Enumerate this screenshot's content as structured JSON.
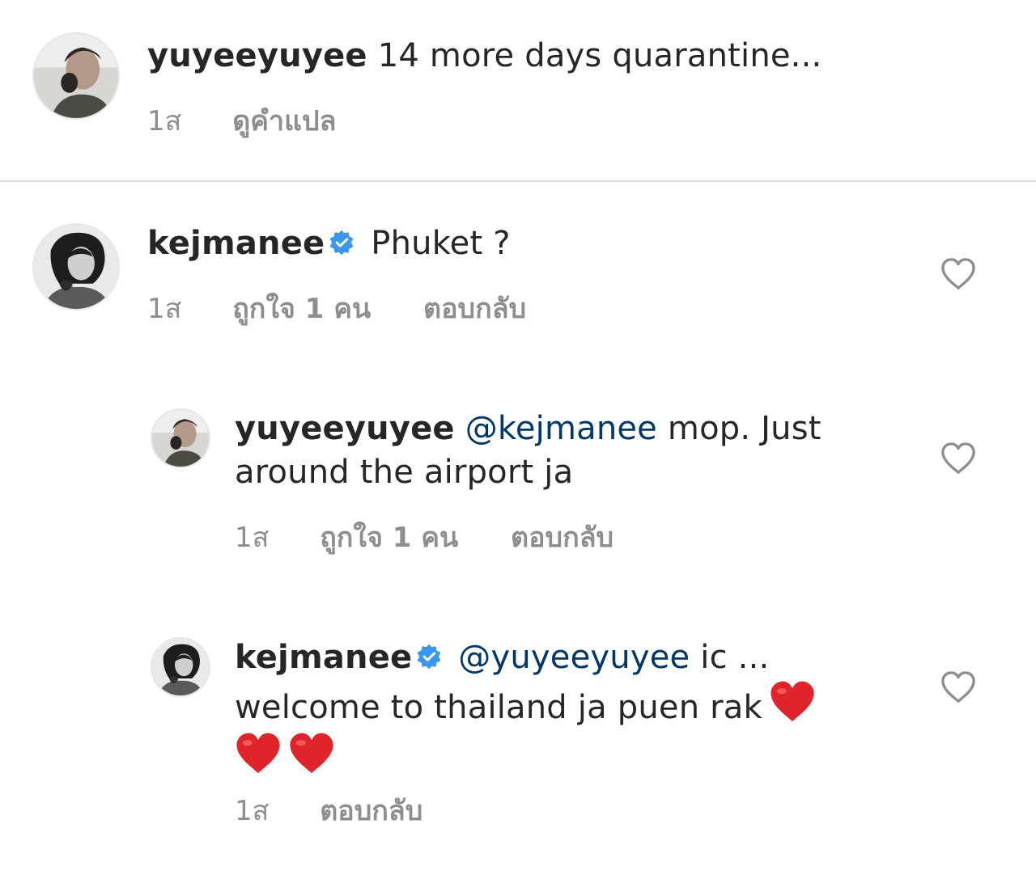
{
  "comments": [
    {
      "username": "yuyeeyuyee",
      "text": "14 more days quarantine...",
      "time": "1ส",
      "translate_label": "ดูคำแปล"
    },
    {
      "username": "kejmanee",
      "verified": true,
      "text": "Phuket ?",
      "time": "1ส",
      "likes_label": "ถูกใจ 1 คน",
      "reply_label": "ตอบกลับ"
    }
  ],
  "replies": [
    {
      "username": "yuyeeyuyee",
      "mention": "@kejmanee",
      "text_line1": "mop. Just",
      "text_line2": "around the airport ja",
      "time": "1ส",
      "likes_label": "ถูกใจ 1 คน",
      "reply_label": "ตอบกลับ"
    },
    {
      "username": "kejmanee",
      "verified": true,
      "mention": "@yuyeeyuyee",
      "text_line1": "ic ...",
      "text_line2": "welcome to thailand ja puen rak",
      "emoji": "❤️",
      "time": "1ส",
      "reply_label": "ตอบกลับ"
    }
  ],
  "icons": {
    "like": "heart-outline-icon",
    "verified": "verified-badge-icon",
    "emoji": "red-heart-emoji"
  },
  "colors": {
    "text": "#262626",
    "meta": "#8e8e8e",
    "mention": "#00376b",
    "verified": "#3897f0",
    "heart_emoji": "#e0242b",
    "divider": "#dbdbdb"
  }
}
